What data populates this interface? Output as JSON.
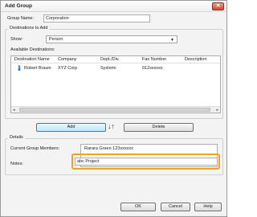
{
  "window": {
    "title": "Add Group",
    "close_glyph": "✕"
  },
  "group_name": {
    "label": "Group Name:",
    "value": "Corporation"
  },
  "destinations": {
    "caption": "Destinations to Add",
    "show_label": "Show:",
    "show_value": "Person",
    "available_label": "Available Destinations:",
    "columns": [
      "Destination Name",
      "Company",
      "Dept./Div.",
      "Fax Number",
      "Description"
    ],
    "rows": [
      {
        "name": "Robert Brawn",
        "company": "XYZ Corp",
        "dept": "Systemi",
        "fax": "012xxxxxx",
        "description": ""
      }
    ]
  },
  "buttons": {
    "add": "Add",
    "delete": "Delete",
    "ok": "OK",
    "cancel": "Cancel",
    "help": "Help"
  },
  "details": {
    "caption": "Details",
    "members_label": "Current Group Members:",
    "members": [
      "Rarara Green    123xxxxxx"
    ],
    "notes_label": "Notes:",
    "notes_value": "abc Project"
  },
  "icons": {
    "person": "person-icon",
    "swap": "swap-arrows-icon",
    "dropdown": "chevron-down-icon"
  },
  "colors": {
    "highlight": "#f0a31d",
    "close": "#c94a31"
  }
}
